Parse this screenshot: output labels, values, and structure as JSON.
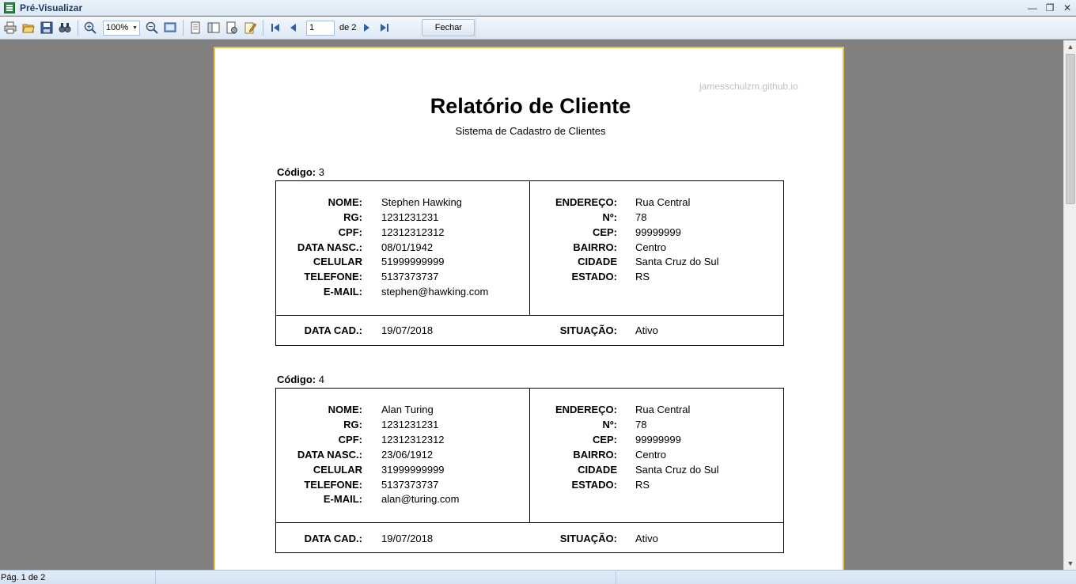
{
  "window": {
    "title": "Pré-Visualizar"
  },
  "toolbar": {
    "zoom": "100%",
    "page_current": "1",
    "page_of": "de 2",
    "close_label": "Fechar"
  },
  "report": {
    "watermark": "jamesschulzm.github.io",
    "title": "Relatório de Cliente",
    "subtitle": "Sistema de Cadastro de Clientes",
    "labels": {
      "code": "Código:",
      "name": "NOME:",
      "rg": "RG:",
      "cpf": "CPF:",
      "birth": "DATA NASC.:",
      "cell": "CELULAR",
      "phone": "TELEFONE:",
      "email": "E-MAIL:",
      "address": "ENDEREÇO:",
      "number": "Nº:",
      "cep": "CEP:",
      "district": "BAIRRO:",
      "city": "CIDADE",
      "state": "ESTADO:",
      "reg_date": "DATA CAD.:",
      "status": "SITUAÇÃO:"
    },
    "clients": [
      {
        "code": "3",
        "name": "Stephen Hawking",
        "rg": "1231231231",
        "cpf": "12312312312",
        "birth": "08/01/1942",
        "cell": "51999999999",
        "phone": "5137373737",
        "email": "stephen@hawking.com",
        "address": "Rua Central",
        "number": "78",
        "cep": "99999999",
        "district": "Centro",
        "city": "Santa Cruz do Sul",
        "state": "RS",
        "reg_date": "19/07/2018",
        "status": "Ativo"
      },
      {
        "code": "4",
        "name": "Alan Turing",
        "rg": "1231231231",
        "cpf": "12312312312",
        "birth": "23/06/1912",
        "cell": "31999999999",
        "phone": "5137373737",
        "email": "alan@turing.com",
        "address": "Rua Central",
        "number": "78",
        "cep": "99999999",
        "district": "Centro",
        "city": "Santa Cruz do Sul",
        "state": "RS",
        "reg_date": "19/07/2018",
        "status": "Ativo"
      }
    ]
  },
  "statusbar": {
    "page_text": "Pág. 1 de 2"
  }
}
